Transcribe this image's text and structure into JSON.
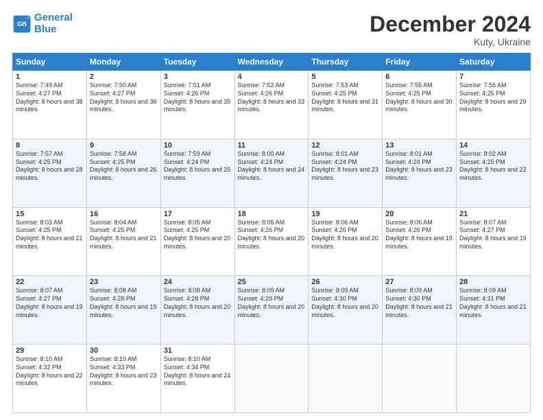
{
  "logo": {
    "line1": "General",
    "line2": "Blue"
  },
  "title": "December 2024",
  "subtitle": "Kuty, Ukraine",
  "header_days": [
    "Sunday",
    "Monday",
    "Tuesday",
    "Wednesday",
    "Thursday",
    "Friday",
    "Saturday"
  ],
  "weeks": [
    [
      {
        "day": "1",
        "sunrise": "Sunrise: 7:49 AM",
        "sunset": "Sunset: 4:27 PM",
        "daylight": "Daylight: 8 hours and 38 minutes."
      },
      {
        "day": "2",
        "sunrise": "Sunrise: 7:50 AM",
        "sunset": "Sunset: 4:27 PM",
        "daylight": "Daylight: 8 hours and 36 minutes."
      },
      {
        "day": "3",
        "sunrise": "Sunrise: 7:51 AM",
        "sunset": "Sunset: 4:26 PM",
        "daylight": "Daylight: 8 hours and 35 minutes."
      },
      {
        "day": "4",
        "sunrise": "Sunrise: 7:52 AM",
        "sunset": "Sunset: 4:26 PM",
        "daylight": "Daylight: 8 hours and 33 minutes."
      },
      {
        "day": "5",
        "sunrise": "Sunrise: 7:53 AM",
        "sunset": "Sunset: 4:25 PM",
        "daylight": "Daylight: 8 hours and 31 minutes."
      },
      {
        "day": "6",
        "sunrise": "Sunrise: 7:55 AM",
        "sunset": "Sunset: 4:25 PM",
        "daylight": "Daylight: 8 hours and 30 minutes."
      },
      {
        "day": "7",
        "sunrise": "Sunrise: 7:56 AM",
        "sunset": "Sunset: 4:25 PM",
        "daylight": "Daylight: 8 hours and 29 minutes."
      }
    ],
    [
      {
        "day": "8",
        "sunrise": "Sunrise: 7:57 AM",
        "sunset": "Sunset: 4:25 PM",
        "daylight": "Daylight: 8 hours and 28 minutes."
      },
      {
        "day": "9",
        "sunrise": "Sunrise: 7:58 AM",
        "sunset": "Sunset: 4:25 PM",
        "daylight": "Daylight: 8 hours and 26 minutes."
      },
      {
        "day": "10",
        "sunrise": "Sunrise: 7:59 AM",
        "sunset": "Sunset: 4:24 PM",
        "daylight": "Daylight: 8 hours and 25 minutes."
      },
      {
        "day": "11",
        "sunrise": "Sunrise: 8:00 AM",
        "sunset": "Sunset: 4:24 PM",
        "daylight": "Daylight: 8 hours and 24 minutes."
      },
      {
        "day": "12",
        "sunrise": "Sunrise: 8:01 AM",
        "sunset": "Sunset: 4:24 PM",
        "daylight": "Daylight: 8 hours and 23 minutes."
      },
      {
        "day": "13",
        "sunrise": "Sunrise: 8:01 AM",
        "sunset": "Sunset: 4:24 PM",
        "daylight": "Daylight: 8 hours and 23 minutes."
      },
      {
        "day": "14",
        "sunrise": "Sunrise: 8:02 AM",
        "sunset": "Sunset: 4:25 PM",
        "daylight": "Daylight: 8 hours and 22 minutes."
      }
    ],
    [
      {
        "day": "15",
        "sunrise": "Sunrise: 8:03 AM",
        "sunset": "Sunset: 4:25 PM",
        "daylight": "Daylight: 8 hours and 21 minutes."
      },
      {
        "day": "16",
        "sunrise": "Sunrise: 8:04 AM",
        "sunset": "Sunset: 4:25 PM",
        "daylight": "Daylight: 8 hours and 21 minutes."
      },
      {
        "day": "17",
        "sunrise": "Sunrise: 8:05 AM",
        "sunset": "Sunset: 4:25 PM",
        "daylight": "Daylight: 8 hours and 20 minutes."
      },
      {
        "day": "18",
        "sunrise": "Sunrise: 8:05 AM",
        "sunset": "Sunset: 4:26 PM",
        "daylight": "Daylight: 8 hours and 20 minutes."
      },
      {
        "day": "19",
        "sunrise": "Sunrise: 8:06 AM",
        "sunset": "Sunset: 4:26 PM",
        "daylight": "Daylight: 8 hours and 20 minutes."
      },
      {
        "day": "20",
        "sunrise": "Sunrise: 8:06 AM",
        "sunset": "Sunset: 4:26 PM",
        "daylight": "Daylight: 8 hours and 19 minutes."
      },
      {
        "day": "21",
        "sunrise": "Sunrise: 8:07 AM",
        "sunset": "Sunset: 4:27 PM",
        "daylight": "Daylight: 8 hours and 19 minutes."
      }
    ],
    [
      {
        "day": "22",
        "sunrise": "Sunrise: 8:07 AM",
        "sunset": "Sunset: 4:27 PM",
        "daylight": "Daylight: 8 hours and 19 minutes."
      },
      {
        "day": "23",
        "sunrise": "Sunrise: 8:08 AM",
        "sunset": "Sunset: 4:28 PM",
        "daylight": "Daylight: 8 hours and 19 minutes."
      },
      {
        "day": "24",
        "sunrise": "Sunrise: 8:08 AM",
        "sunset": "Sunset: 4:28 PM",
        "daylight": "Daylight: 8 hours and 20 minutes."
      },
      {
        "day": "25",
        "sunrise": "Sunrise: 8:09 AM",
        "sunset": "Sunset: 4:29 PM",
        "daylight": "Daylight: 8 hours and 20 minutes."
      },
      {
        "day": "26",
        "sunrise": "Sunrise: 8:09 AM",
        "sunset": "Sunset: 4:30 PM",
        "daylight": "Daylight: 8 hours and 20 minutes."
      },
      {
        "day": "27",
        "sunrise": "Sunrise: 8:09 AM",
        "sunset": "Sunset: 4:30 PM",
        "daylight": "Daylight: 8 hours and 21 minutes."
      },
      {
        "day": "28",
        "sunrise": "Sunrise: 8:09 AM",
        "sunset": "Sunset: 4:31 PM",
        "daylight": "Daylight: 8 hours and 21 minutes."
      }
    ],
    [
      {
        "day": "29",
        "sunrise": "Sunrise: 8:10 AM",
        "sunset": "Sunset: 4:32 PM",
        "daylight": "Daylight: 8 hours and 22 minutes."
      },
      {
        "day": "30",
        "sunrise": "Sunrise: 8:10 AM",
        "sunset": "Sunset: 4:33 PM",
        "daylight": "Daylight: 8 hours and 23 minutes."
      },
      {
        "day": "31",
        "sunrise": "Sunrise: 8:10 AM",
        "sunset": "Sunset: 4:34 PM",
        "daylight": "Daylight: 8 hours and 24 minutes."
      },
      null,
      null,
      null,
      null
    ]
  ],
  "colors": {
    "header_bg": "#2a7fcf",
    "row_even": "#f0f5fb",
    "row_odd": "#ffffff"
  }
}
